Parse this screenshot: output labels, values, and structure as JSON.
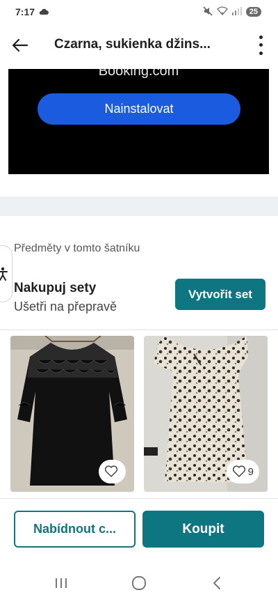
{
  "status_bar": {
    "time": "7:17",
    "battery": "25"
  },
  "header": {
    "title": "Czarna, sukienka džins..."
  },
  "ad": {
    "brand": "Booking.com",
    "install_label": "Nainstalovat"
  },
  "wardrobe": {
    "section_title": "Předměty v tomto šatníku",
    "bundle_title": "Nakupuj sety",
    "bundle_subtitle": "Ušetři na přepravě",
    "create_set_label": "Vytvořit set"
  },
  "products": [
    {
      "likes": ""
    },
    {
      "likes": "9"
    }
  ],
  "actions": {
    "offer_label": "Nabídnout c...",
    "buy_label": "Koupit"
  },
  "colors": {
    "accent": "#0d7680",
    "ad_button": "#1a5be0"
  }
}
